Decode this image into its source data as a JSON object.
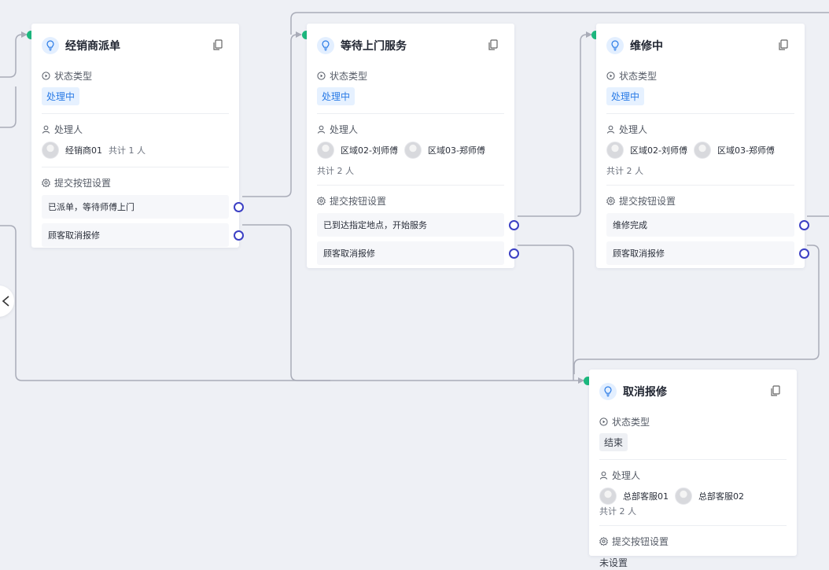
{
  "nodes": [
    {
      "id": "dealer",
      "title": "经销商派单",
      "status_label": "状态类型",
      "status": "处理中",
      "handler_label": "处理人",
      "handlers": [
        "经销商01"
      ],
      "handler_total": "共计 1 人",
      "submit_label": "提交按钮设置",
      "buttons": [
        "已派单，等待师傅上门",
        "顾客取消报修"
      ]
    },
    {
      "id": "waiting",
      "title": "等待上门服务",
      "status_label": "状态类型",
      "status": "处理中",
      "handler_label": "处理人",
      "handlers": [
        "区域02-刘师傅",
        "区域03-郑师傅"
      ],
      "handler_total": "共计 2 人",
      "submit_label": "提交按钮设置",
      "buttons": [
        "已到达指定地点，开始服务",
        "顾客取消报修"
      ]
    },
    {
      "id": "repairing",
      "title": "维修中",
      "status_label": "状态类型",
      "status": "处理中",
      "handler_label": "处理人",
      "handlers": [
        "区域02-刘师傅",
        "区域03-郑师傅"
      ],
      "handler_total": "共计 2 人",
      "submit_label": "提交按钮设置",
      "buttons": [
        "维修完成",
        "顾客取消报修"
      ]
    },
    {
      "id": "cancel",
      "title": "取消报修",
      "status_label": "状态类型",
      "status": "结束",
      "handler_label": "处理人",
      "handlers": [
        "总部客服01",
        "总部客服02"
      ],
      "handler_total": "共计 2 人",
      "submit_label": "提交按钮设置",
      "submit_value": "未设置"
    }
  ],
  "colors": {
    "canvas": "#eef0f5",
    "edge": "#a9acb8",
    "port": "#3b3fc4",
    "entry_dot": "#1cb87e",
    "status_active": "#2a7be6",
    "status_end": "#3a3f4a"
  },
  "icons": [
    "bulb-icon",
    "copy-icon",
    "play-circle-icon",
    "user-icon",
    "gear-icon",
    "chevron-left-icon"
  ]
}
